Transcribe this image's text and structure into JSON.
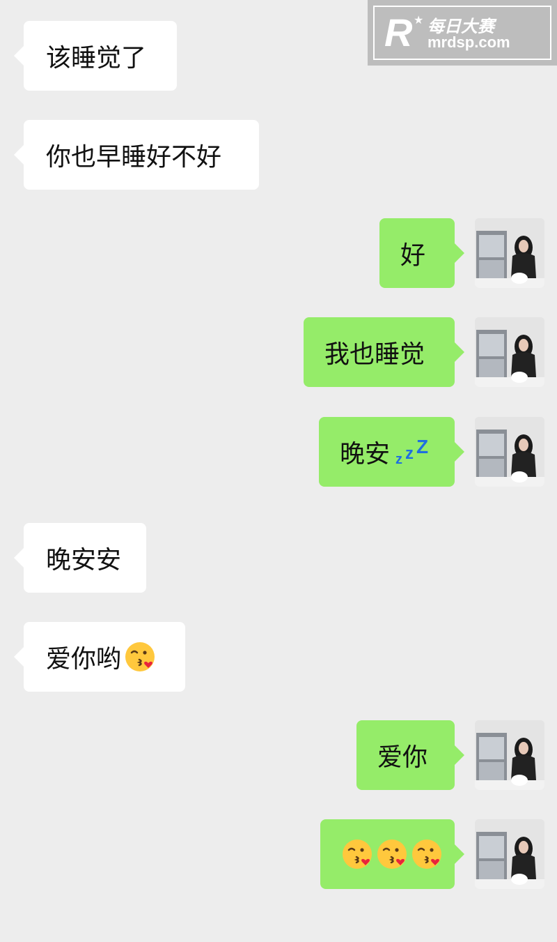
{
  "watermark": {
    "title": "每日大赛",
    "url": "mrdsp.com",
    "logo_letter": "R"
  },
  "messages": [
    {
      "side": "in",
      "text": "该睡觉了"
    },
    {
      "side": "in",
      "text": "你也早睡好不好"
    },
    {
      "side": "out",
      "text": "好"
    },
    {
      "side": "out",
      "text": "我也睡觉"
    },
    {
      "side": "out",
      "text": "晚安",
      "decoration": "zzz-icon"
    },
    {
      "side": "in",
      "text": "晚安安"
    },
    {
      "side": "in",
      "text": "爱你哟",
      "emoji": "kissing-heart-emoji"
    },
    {
      "side": "out",
      "text": "爱你"
    },
    {
      "side": "out",
      "text": "",
      "emoji": "kissing-heart-emoji",
      "emoji_count": 3
    }
  ],
  "zzz": {
    "z1": "z",
    "z2": "z",
    "z3": "Z"
  },
  "colors": {
    "background": "#ededed",
    "incoming_bubble": "#ffffff",
    "outgoing_bubble": "#95ec69",
    "zzz": "#1f6fe0"
  }
}
